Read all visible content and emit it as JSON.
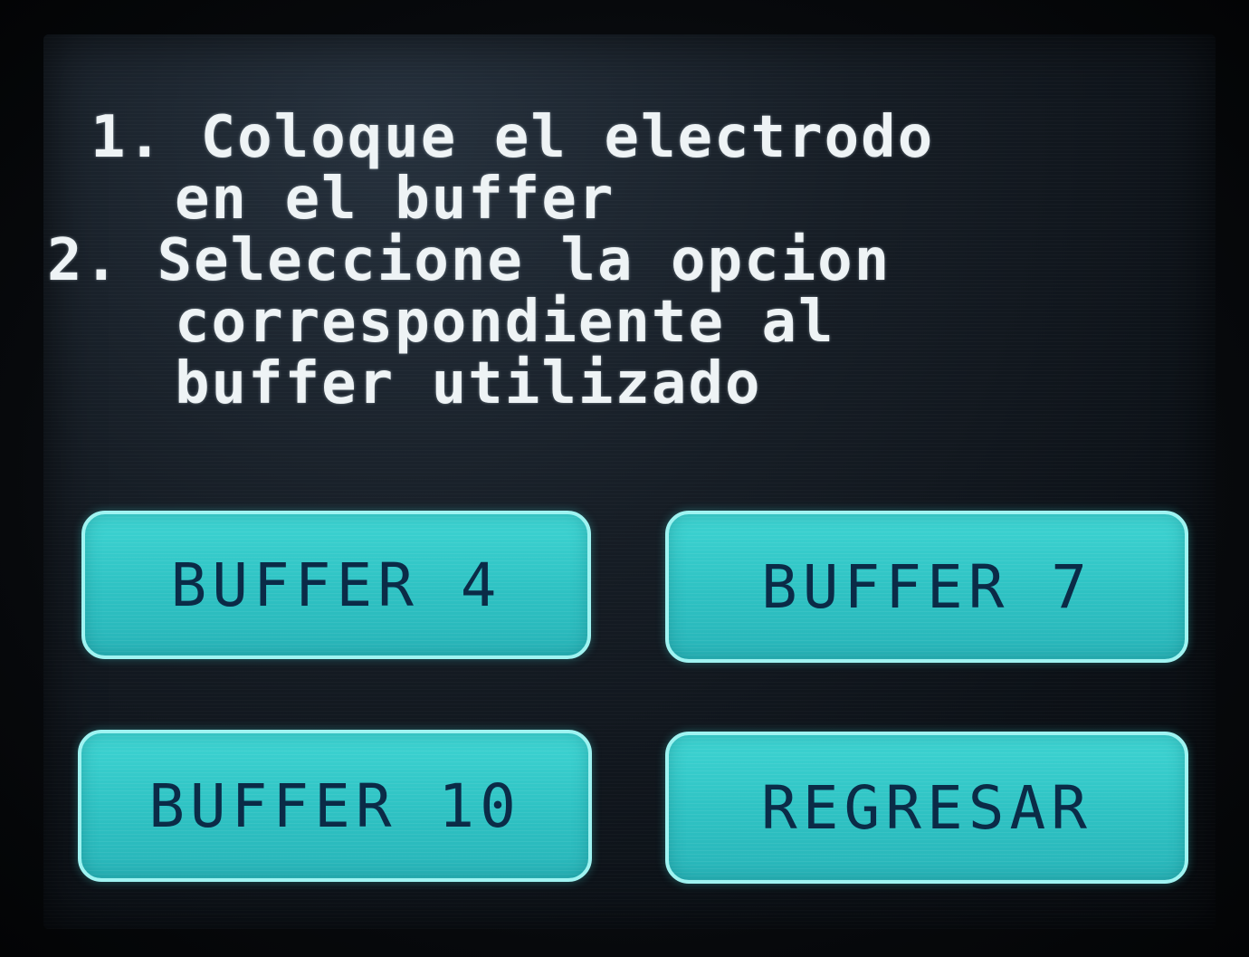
{
  "instructions": {
    "lines": [
      "1. Coloque el electrodo",
      "en el buffer",
      "2. Seleccione la opcion",
      "correspondiente al",
      "buffer utilizado"
    ]
  },
  "buttons": {
    "buffer4": "BUFFER 4",
    "buffer7": "BUFFER 7",
    "buffer10": "BUFFER 10",
    "back": "REGRESAR"
  },
  "colors": {
    "screen_background": "#161d25",
    "text": "#eef3f5",
    "button_fill": "#2fc3c4",
    "button_border": "#9ff3f1",
    "button_text": "#0b2b47"
  }
}
